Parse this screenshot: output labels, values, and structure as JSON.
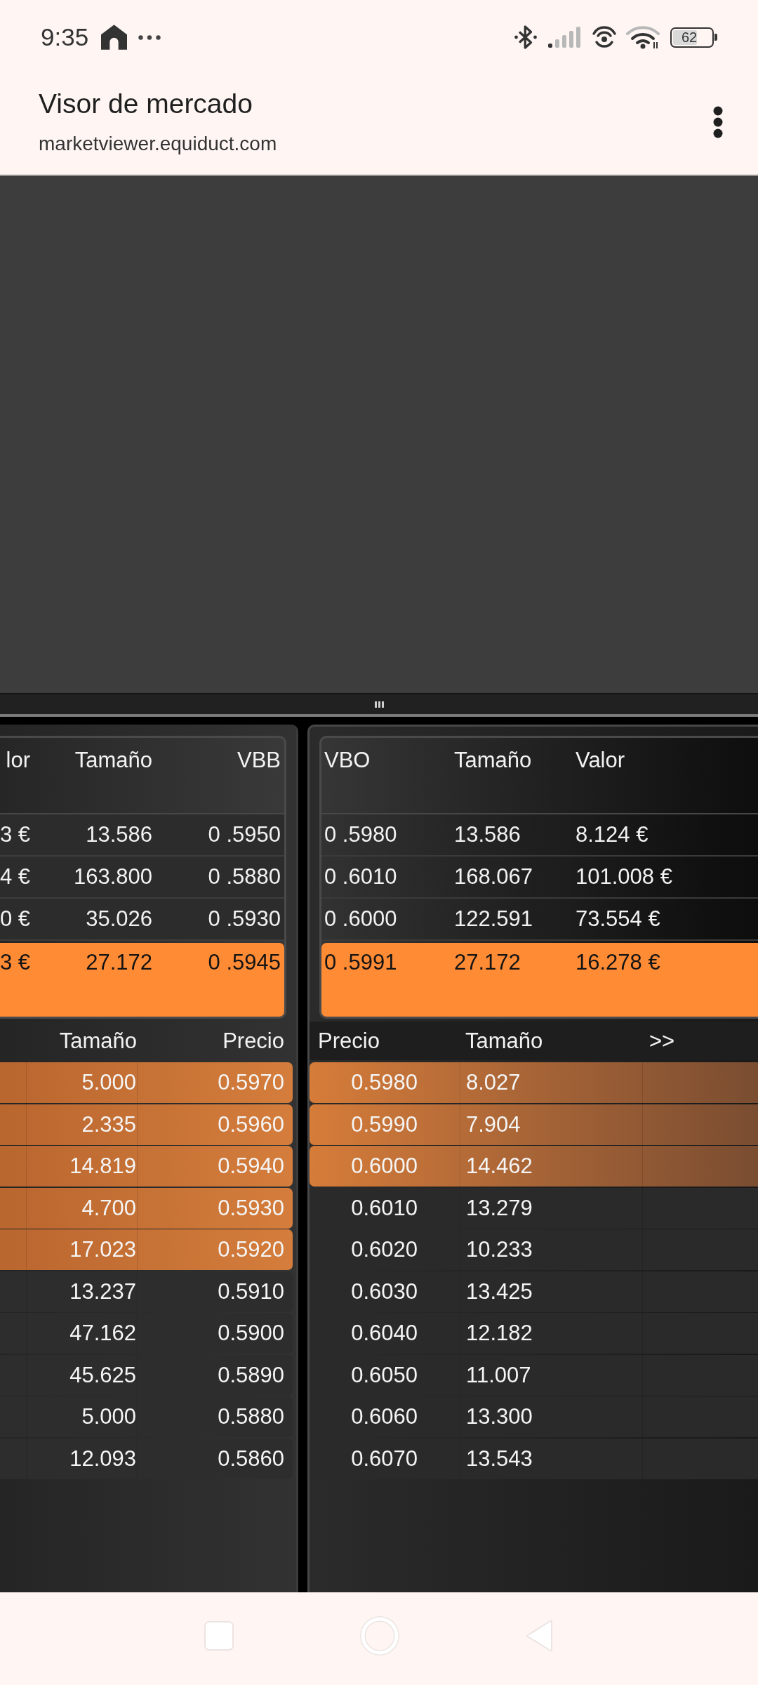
{
  "status_bar": {
    "time": "9:35",
    "battery": "62"
  },
  "browser": {
    "title": "Visor de mercado",
    "url": "marketviewer.equiduct.com"
  },
  "bid_panel": {
    "summary": {
      "columns": [
        "lor",
        "Tamaño",
        "VBB"
      ],
      "rows": [
        {
          "cells": [
            "3 €",
            "13.586",
            "0 .5950"
          ],
          "highlighted": false
        },
        {
          "cells": [
            "4 €",
            "163.800",
            "0 .5880"
          ],
          "highlighted": false
        },
        {
          "cells": [
            "0 €",
            "35.026",
            "0 .5930"
          ],
          "highlighted": false
        },
        {
          "cells": [
            "3 €",
            "27.172",
            "0 .5945"
          ],
          "highlighted": true
        }
      ]
    },
    "book": {
      "columns": [
        "Tamaño",
        "Precio"
      ],
      "rows": [
        {
          "cells": [
            "5.000",
            "0.5970"
          ],
          "highlighted": true
        },
        {
          "cells": [
            "2.335",
            "0.5960"
          ],
          "highlighted": true
        },
        {
          "cells": [
            "14.819",
            "0.5940"
          ],
          "highlighted": true
        },
        {
          "cells": [
            "4.700",
            "0.5930"
          ],
          "highlighted": true
        },
        {
          "cells": [
            "17.023",
            "0.5920"
          ],
          "highlighted": true
        },
        {
          "cells": [
            "13.237",
            "0.5910"
          ],
          "highlighted": false
        },
        {
          "cells": [
            "47.162",
            "0.5900"
          ],
          "highlighted": false
        },
        {
          "cells": [
            "45.625",
            "0.5890"
          ],
          "highlighted": false
        },
        {
          "cells": [
            "5.000",
            "0.5880"
          ],
          "highlighted": false
        },
        {
          "cells": [
            "12.093",
            "0.5860"
          ],
          "highlighted": false
        }
      ]
    }
  },
  "ask_panel": {
    "summary": {
      "columns": [
        "VBO",
        "Tamaño",
        "Valor"
      ],
      "rows": [
        {
          "cells": [
            "0 .5980",
            "13.586",
            "8.124 €"
          ],
          "highlighted": false
        },
        {
          "cells": [
            "0 .6010",
            "168.067",
            "101.008 €"
          ],
          "highlighted": false
        },
        {
          "cells": [
            "0 .6000",
            "122.591",
            "73.554 €"
          ],
          "highlighted": false
        },
        {
          "cells": [
            "0 .5991",
            "27.172",
            "16.278 €"
          ],
          "highlighted": true
        }
      ]
    },
    "book": {
      "columns": [
        "Precio",
        "Tamaño",
        ">>"
      ],
      "rows": [
        {
          "cells": [
            "0.5980",
            "8.027"
          ],
          "highlighted": true
        },
        {
          "cells": [
            "0.5990",
            "7.904"
          ],
          "highlighted": true
        },
        {
          "cells": [
            "0.6000",
            "14.462"
          ],
          "highlighted": true
        },
        {
          "cells": [
            "0.6010",
            "13.279"
          ],
          "highlighted": false
        },
        {
          "cells": [
            "0.6020",
            "10.233"
          ],
          "highlighted": false
        },
        {
          "cells": [
            "0.6030",
            "13.425"
          ],
          "highlighted": false
        },
        {
          "cells": [
            "0.6040",
            "12.182"
          ],
          "highlighted": false
        },
        {
          "cells": [
            "0.6050",
            "11.007"
          ],
          "highlighted": false
        },
        {
          "cells": [
            "0.6060",
            "13.300"
          ],
          "highlighted": false
        },
        {
          "cells": [
            "0.6070",
            "13.543"
          ],
          "highlighted": false
        }
      ]
    }
  }
}
